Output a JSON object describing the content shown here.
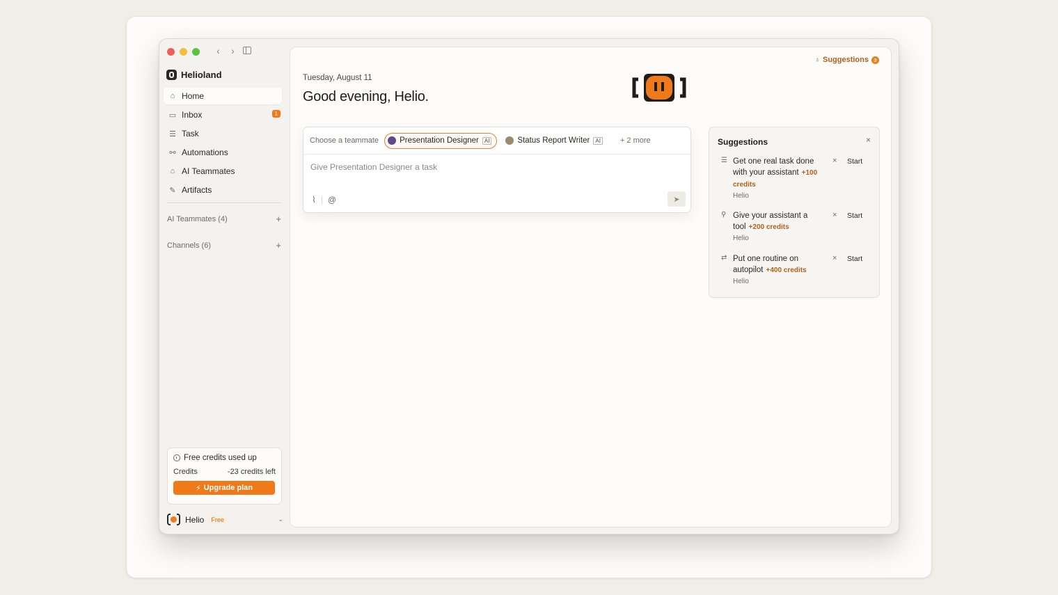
{
  "workspace": {
    "name": "Helioland"
  },
  "nav": [
    {
      "label": "Home",
      "icon": "home-icon",
      "glyph": "⌂",
      "active": true
    },
    {
      "label": "Inbox",
      "icon": "inbox-icon",
      "glyph": "▭",
      "badge": "1"
    },
    {
      "label": "Task",
      "icon": "task-list-icon",
      "glyph": "☰"
    },
    {
      "label": "Automations",
      "icon": "automations-icon",
      "glyph": "⚯"
    },
    {
      "label": "AI Teammates",
      "icon": "ai-teammates-icon",
      "glyph": "⌂"
    },
    {
      "label": "Artifacts",
      "icon": "artifacts-icon",
      "glyph": "✎"
    }
  ],
  "sections": {
    "teammates_label": "AI Teammates (4)",
    "channels_label": "Channels (6)",
    "add": "+"
  },
  "credits": {
    "heading": "Free credits used up",
    "label": "Credits",
    "value": "-23 credits left",
    "upgrade_label": "Upgrade plan",
    "upgrade_glyph": "⚡"
  },
  "user": {
    "name": "Helio",
    "plan": "Free"
  },
  "header": {
    "suggestions_label": "Suggestions",
    "suggestions_count": "3",
    "date": "Tuesday, August 11",
    "greeting": "Good evening, Helio."
  },
  "composer": {
    "choose_label": "Choose a teammate",
    "teammates": [
      {
        "name": "Presentation Designer",
        "tag": "AI",
        "selected": true,
        "color": "#5a4a8a"
      },
      {
        "name": "Status Report Writer",
        "tag": "AI",
        "selected": false,
        "color": "#9a8a70"
      }
    ],
    "more_label": "+ 2 more",
    "placeholder": "Give Presentation Designer a task",
    "attach_glyph": "⌇",
    "mention_glyph": "@",
    "send_glyph": "➤"
  },
  "suggestions": {
    "title": "Suggestions",
    "close_glyph": "×",
    "items": [
      {
        "text": "Get one real task done with your assistant",
        "credits": "+100 credits",
        "author": "Helio",
        "glyph": "☰",
        "dismiss": "×",
        "action": "Start"
      },
      {
        "text": "Give your assistant a tool",
        "credits": "+200 credits",
        "author": "Helio",
        "glyph": "⚲",
        "dismiss": "×",
        "action": "Start"
      },
      {
        "text": "Put one routine on autopilot",
        "credits": "+400 credits",
        "author": "Helio",
        "glyph": "⇄",
        "dismiss": "×",
        "action": "Start"
      }
    ]
  },
  "colors": {
    "accent": "#f07a1a",
    "accent_text": "#b0601a"
  }
}
